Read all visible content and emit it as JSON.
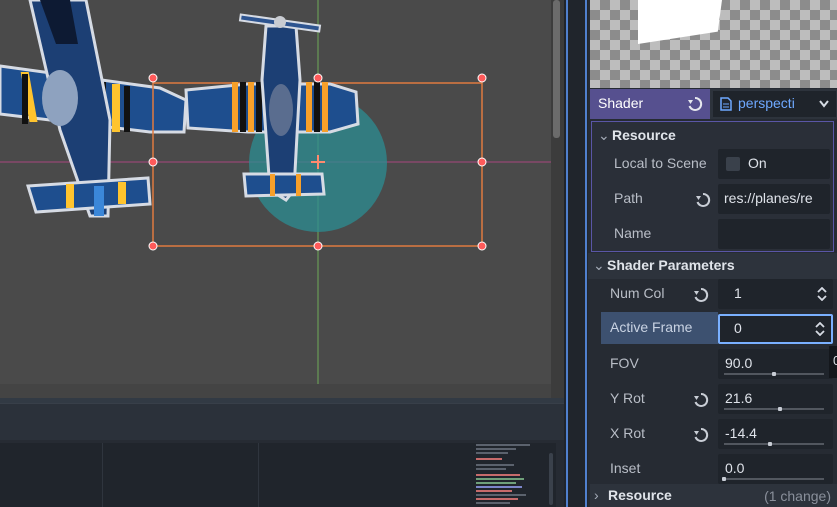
{
  "inspector": {
    "shader": {
      "label": "Shader",
      "resource_name": "perspecti"
    },
    "resource_section": {
      "title": "Resource",
      "local_to_scene_label": "Local to Scene",
      "local_to_scene_value": "On",
      "path_label": "Path",
      "path_value": "res://planes/re",
      "name_label": "Name",
      "name_value": ""
    },
    "shader_parameters": {
      "title": "Shader Parameters",
      "params": [
        {
          "label": "Num Col",
          "value": "1",
          "revert": true
        },
        {
          "label": "Active Frame",
          "value": "0",
          "revert": false
        },
        {
          "label": "FOV",
          "value": "90.0",
          "revert": false,
          "level": 0.5
        },
        {
          "label": "Y Rot",
          "value": "21.6",
          "revert": true,
          "level": 0.56
        },
        {
          "label": "X Rot",
          "value": "-14.4",
          "revert": true,
          "level": 0.46
        },
        {
          "label": "Inset",
          "value": "0.0",
          "revert": false,
          "level": 0.0
        }
      ]
    },
    "footer": {
      "title": "Resource",
      "changes": "(1 change)"
    },
    "tooltip_partial": "0"
  },
  "colors": {
    "accent": "#558be0",
    "shader_label_bg": "#56508f",
    "selection": "#e07a3f",
    "resource_link": "#6ea8ff"
  },
  "icons": {
    "revert": "revert-icon",
    "doc": "document-icon",
    "dropdown": "chevron-down-icon",
    "spin": "spinner-arrows-icon"
  }
}
